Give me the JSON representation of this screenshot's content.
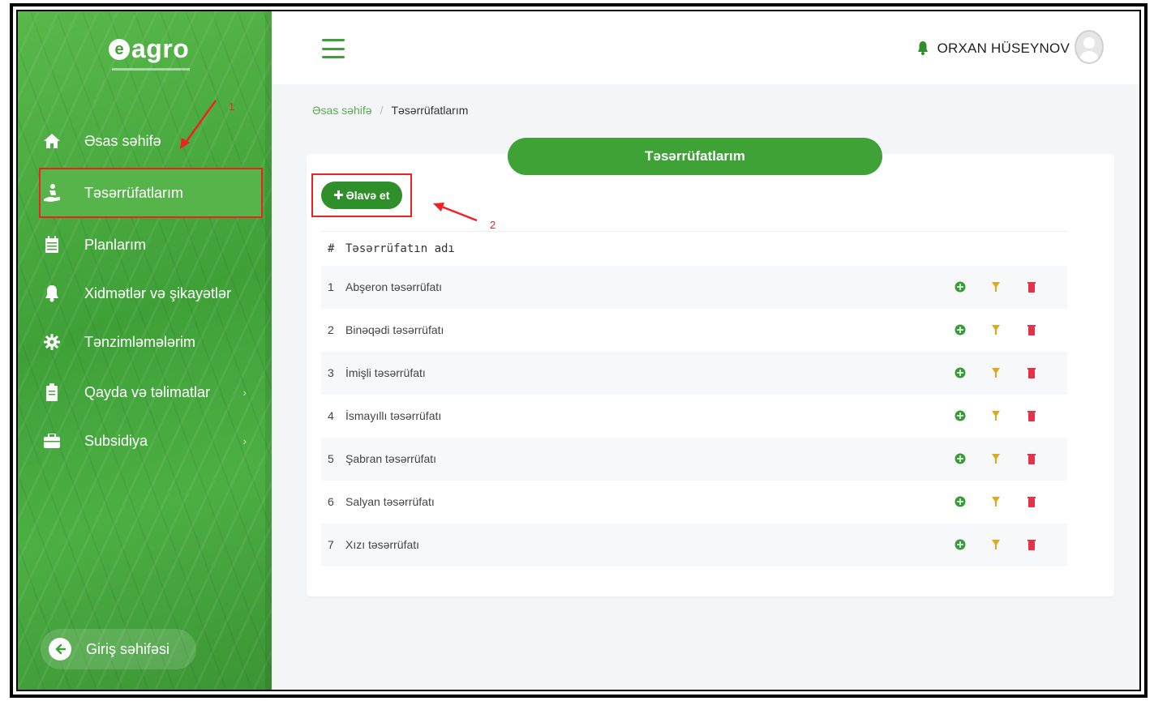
{
  "logo": {
    "mark": "e",
    "text": "agro"
  },
  "sidebar": {
    "items": [
      {
        "label": "Əsas səhifə",
        "icon": "home-icon"
      },
      {
        "label": "Təsərrüfatlarım",
        "icon": "farmer-icon"
      },
      {
        "label": "Planlarım",
        "icon": "calendar-icon"
      },
      {
        "label": "Xidmətlər və şikayətlər",
        "icon": "bell-icon"
      },
      {
        "label": "Tənzimləmələrim",
        "icon": "gear-icon"
      },
      {
        "label": "Qayda və təlimatlar",
        "icon": "clipboard-icon",
        "chevron": "›"
      },
      {
        "label": "Subsidiya",
        "icon": "briefcase-icon",
        "chevron": "›"
      }
    ],
    "home_button": "Giriş səhifəsi"
  },
  "header": {
    "user_name": "ORXAN HÜSEYNOV"
  },
  "breadcrumb": {
    "home": "Əsas səhifə",
    "separator": "/",
    "current": "Təsərrüfatlarım"
  },
  "main": {
    "title": "Təsərrüfatlarım",
    "add_button": "Əlavə et",
    "annotation_1": "1",
    "annotation_2": "2",
    "table": {
      "columns": [
        "#",
        "Təsərrüfatın adı"
      ],
      "rows": [
        {
          "num": "1",
          "name": "Abşeron təsərrüfatı"
        },
        {
          "num": "2",
          "name": "Binəqədi təsərrüfatı"
        },
        {
          "num": "3",
          "name": "İmişli təsərrüfatı"
        },
        {
          "num": "4",
          "name": "İsmayıllı təsərrüfatı"
        },
        {
          "num": "5",
          "name": "Şabran təsərrüfatı"
        },
        {
          "num": "6",
          "name": "Salyan təsərrüfatı"
        },
        {
          "num": "7",
          "name": "Xızı təsərrüfatı"
        }
      ]
    }
  },
  "colors": {
    "brand_green": "#3ea236",
    "annotation_red": "#e22222",
    "action_view": "#3a9a3a",
    "action_edit": "#e0a81a",
    "action_delete": "#e2334a"
  }
}
